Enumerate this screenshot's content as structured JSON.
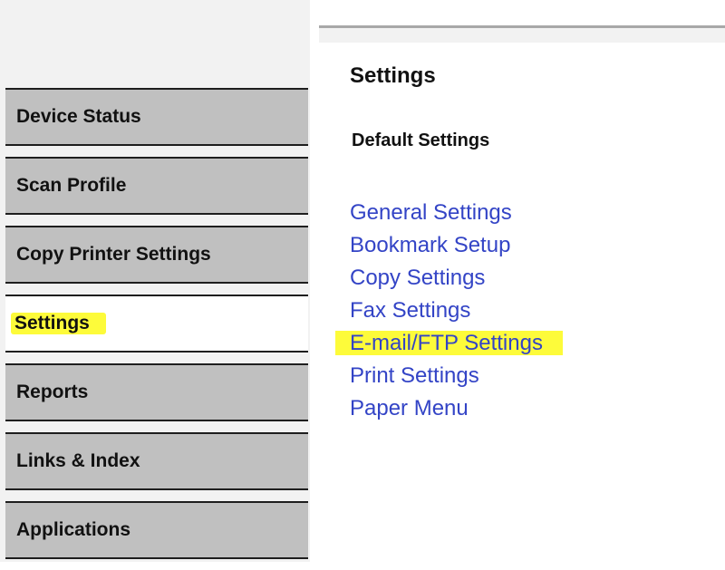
{
  "sidebar": {
    "items": [
      {
        "label": "Device Status"
      },
      {
        "label": "Scan Profile"
      },
      {
        "label": "Copy Printer Settings"
      },
      {
        "label": "Settings"
      },
      {
        "label": "Reports"
      },
      {
        "label": "Links & Index"
      },
      {
        "label": "Applications"
      }
    ],
    "active_item": "Settings"
  },
  "main": {
    "title": "Settings",
    "section_title": "Default Settings",
    "links": [
      {
        "label": "General Settings"
      },
      {
        "label": "Bookmark Setup"
      },
      {
        "label": "Copy Settings"
      },
      {
        "label": "Fax Settings"
      },
      {
        "label": "E-mail/FTP Settings"
      },
      {
        "label": "Print Settings"
      },
      {
        "label": "Paper Menu"
      }
    ]
  },
  "colors": {
    "nav_background": "#c0c0c0",
    "nav_active_background": "#ffffff",
    "link": "#3344c6",
    "highlighter": "#fdfb3a"
  }
}
